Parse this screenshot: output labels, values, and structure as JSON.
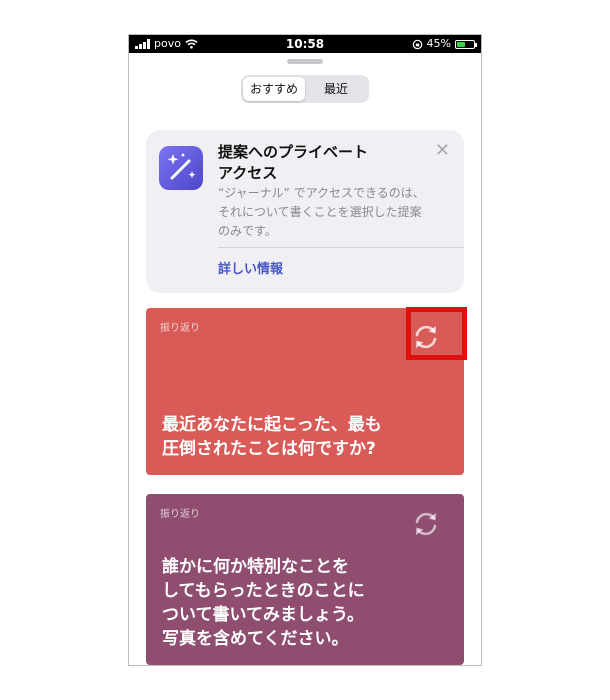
{
  "status_bar": {
    "carrier": "povo",
    "time": "10:58",
    "battery_percent": "45%",
    "battery_level": 0.45
  },
  "segmented_control": {
    "tabs": [
      "おすすめ",
      "最近"
    ],
    "selected_index": 0
  },
  "privacy_card": {
    "title_line1": "提案へのプライベート",
    "title_line2": "アクセス",
    "body_line1": "“ジャーナル” でアクセスできるのは、",
    "body_line2": "それについて書くことを選択した提案",
    "body_line3": "のみです。",
    "link_label": "詳しい情報",
    "close_icon": "close-icon"
  },
  "prompt_cards": [
    {
      "category": "振り返り",
      "question": "最近あなたに起こった、最も\n圧倒されたことは何ですか?",
      "color": "#d95b58",
      "highlighted": true
    },
    {
      "category": "振り返り",
      "question": "誰かに何か特別なことを\nしてもらったときのことに\nついて書いてみましょう。\n写真を含めてください。",
      "color": "#8f4d70",
      "highlighted": false
    }
  ],
  "colors": {
    "link": "#4857c7",
    "highlight": "#e01010"
  }
}
